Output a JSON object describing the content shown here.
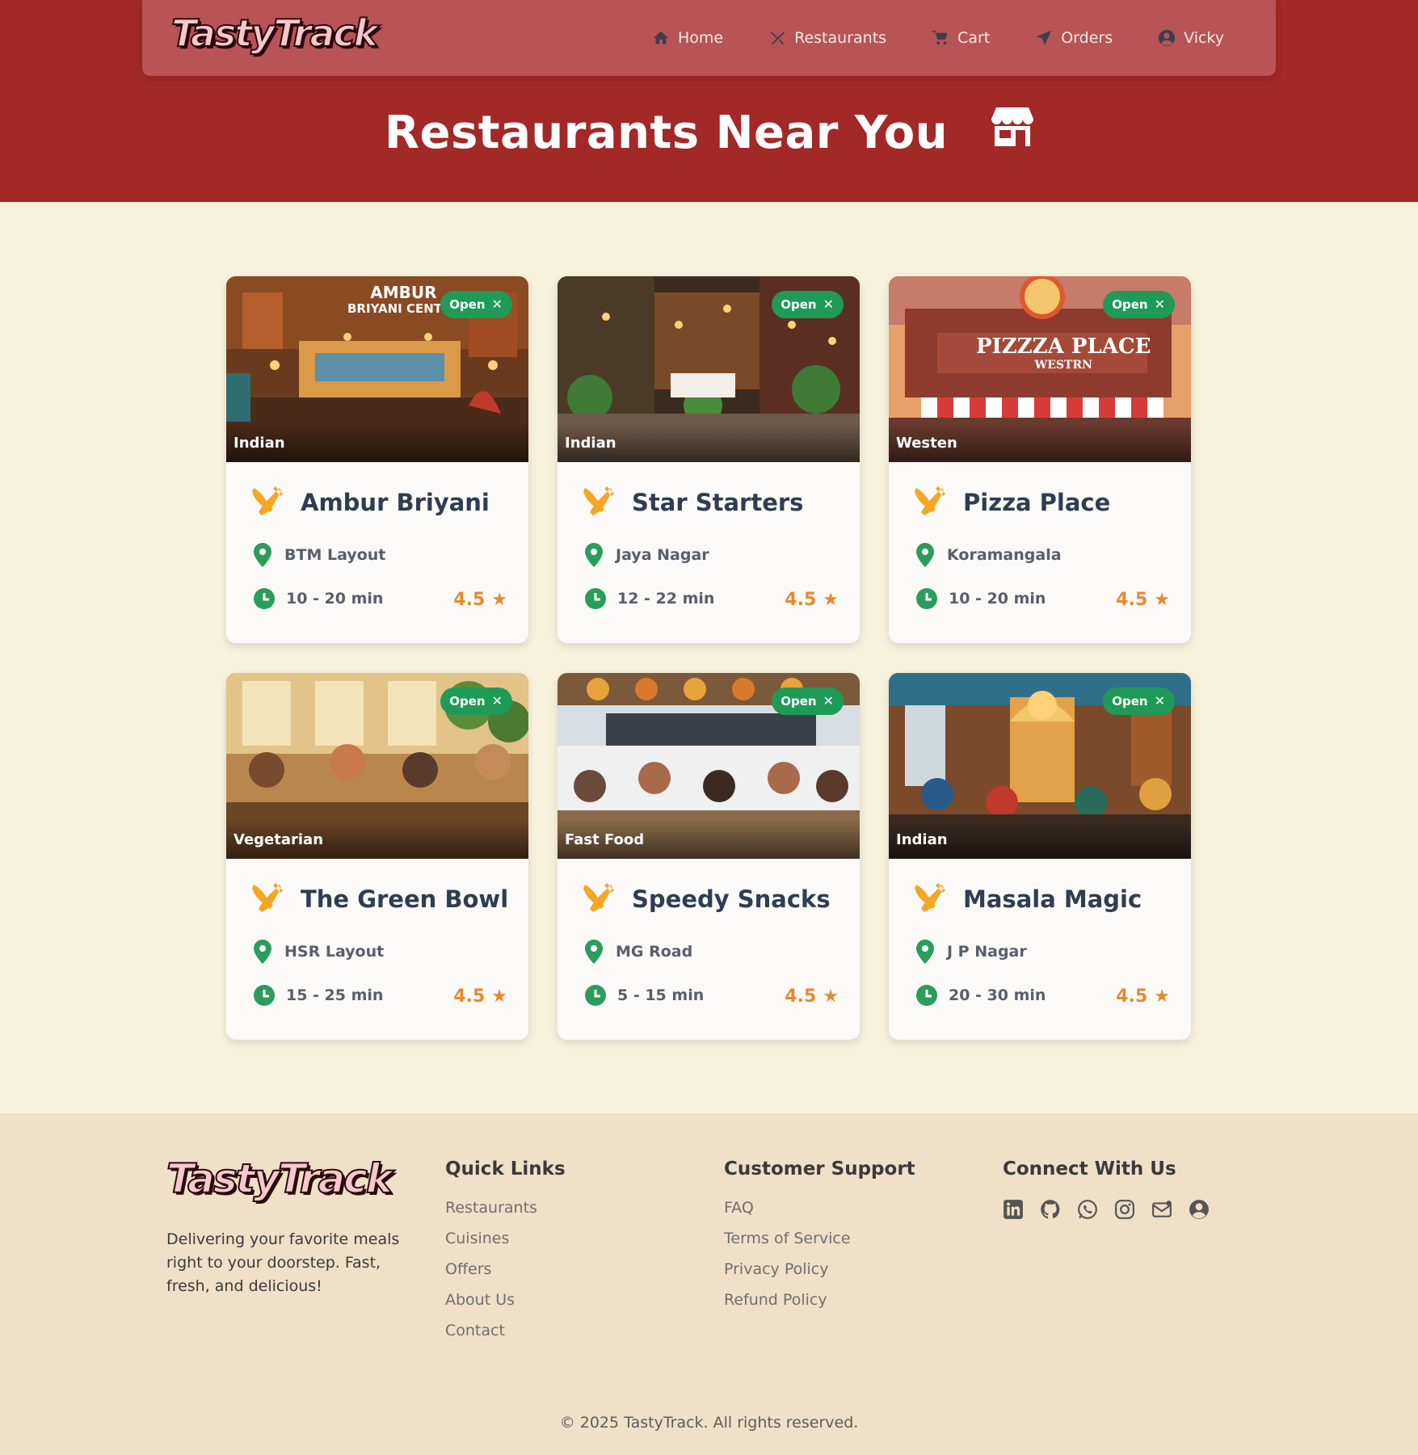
{
  "brand": {
    "name_part1": "Tasty",
    "name_part2": "Track"
  },
  "nav": {
    "items": [
      {
        "label": "Home",
        "icon": "home-icon"
      },
      {
        "label": "Restaurants",
        "icon": "utensils-icon"
      },
      {
        "label": "Cart",
        "icon": "cart-icon"
      },
      {
        "label": "Orders",
        "icon": "paper-plane-icon"
      },
      {
        "label": "Vicky",
        "icon": "user-circle-icon"
      }
    ]
  },
  "hero": {
    "title": "Restaurants Near You",
    "icon": "store-icon"
  },
  "colors": {
    "primary": "#a32828",
    "nav": "#b85455",
    "open_badge": "#1f9b57",
    "accent": "#f5a623",
    "rating": "#e68a2f",
    "page_bg": "#f6f2dc",
    "footer_bg": "#f0e0c7"
  },
  "restaurants": [
    {
      "name": "Ambur Briyani",
      "cuisine": "Indian",
      "status": "Open",
      "location": "BTM Layout",
      "time": "10 - 20 min",
      "rating": "4.5",
      "sign": [
        "AMBUR",
        "BRIYANI CENTER"
      ]
    },
    {
      "name": "Star Starters",
      "cuisine": "Indian",
      "status": "Open",
      "location": "Jaya Nagar",
      "time": "12 - 22 min",
      "rating": "4.5"
    },
    {
      "name": "Pizza Place",
      "cuisine": "Westen",
      "status": "Open",
      "location": "Koramangala",
      "time": "10 - 20 min",
      "rating": "4.5",
      "sign": [
        "PIZZZA PLACE",
        "WESTRN"
      ]
    },
    {
      "name": "The Green Bowl",
      "cuisine": "Vegetarian",
      "status": "Open",
      "location": "HSR Layout",
      "time": "15 - 25 min",
      "rating": "4.5"
    },
    {
      "name": "Speedy Snacks",
      "cuisine": "Fast Food",
      "status": "Open",
      "location": "MG Road",
      "time": "5 - 15 min",
      "rating": "4.5"
    },
    {
      "name": "Masala Magic",
      "cuisine": "Indian",
      "status": "Open",
      "location": "J P Nagar",
      "time": "20 - 30 min",
      "rating": "4.5"
    }
  ],
  "footer": {
    "tagline": "Delivering your favorite meals right to your doorstep. Fast, fresh, and delicious!",
    "quick_links": {
      "title": "Quick Links",
      "links": [
        "Restaurants",
        "Cuisines",
        "Offers",
        "About Us",
        "Contact"
      ]
    },
    "support": {
      "title": "Customer Support",
      "links": [
        "FAQ",
        "Terms of Service",
        "Privacy Policy",
        "Refund Policy"
      ]
    },
    "connect": {
      "title": "Connect With Us",
      "icons": [
        "linkedin-icon",
        "github-icon",
        "whatsapp-icon",
        "instagram-icon",
        "mail-icon",
        "user-circle-icon"
      ]
    },
    "copyright": "© 2025 TastyTrack. All rights reserved."
  }
}
